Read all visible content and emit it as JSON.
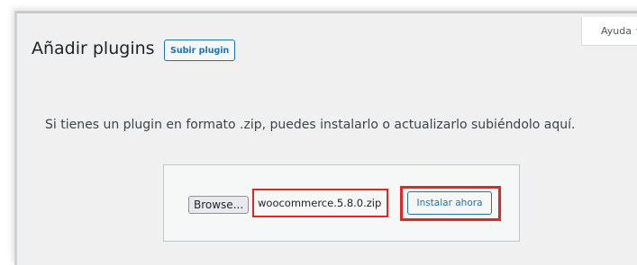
{
  "help_tab": {
    "label": "Ayuda",
    "caret": "▼"
  },
  "header": {
    "title": "Añadir plugins",
    "upload_button_label": "Subir plugin"
  },
  "upload": {
    "help_text": "Si tienes un plugin en formato .zip, puedes instalarlo o actualizarlo subiéndolo aquí.",
    "browse_label": "Browse...",
    "file_name": "woocommerce.5.8.0.zip",
    "install_label": "Instalar ahora"
  },
  "colors": {
    "accent": "#2271b1",
    "highlight": "#e0262a",
    "background": "#f0f0f1"
  }
}
